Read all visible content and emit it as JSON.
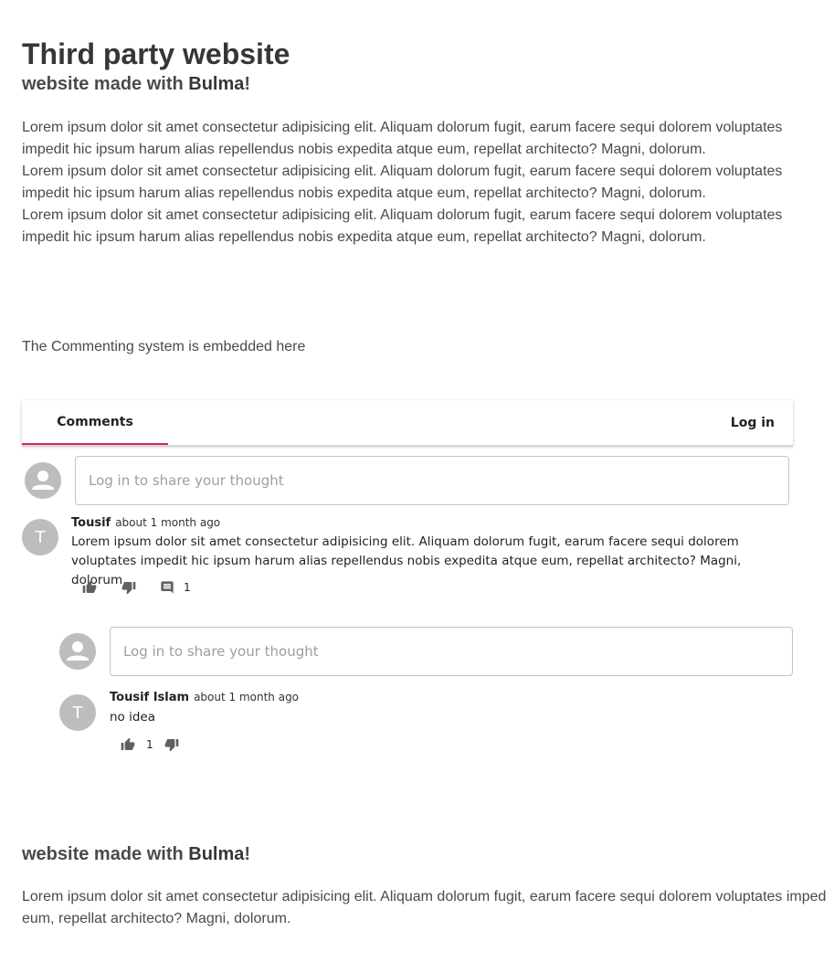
{
  "header": {
    "title": "Third party website",
    "subtitle_prefix": "website made with ",
    "subtitle_brand": "Bulma",
    "subtitle_suffix": "!"
  },
  "intro": {
    "paragraphs": [
      "Lorem ipsum dolor sit amet consectetur adipisicing elit. Aliquam dolorum fugit, earum facere sequi dolorem voluptates impedit hic ipsum harum alias repellendus nobis expedita atque eum, repellat architecto? Magni, dolorum.",
      "Lorem ipsum dolor sit amet consectetur adipisicing elit. Aliquam dolorum fugit, earum facere sequi dolorem voluptates impedit hic ipsum harum alias repellendus nobis expedita atque eum, repellat architecto? Magni, dolorum.",
      "Lorem ipsum dolor sit amet consectetur adipisicing elit. Aliquam dolorum fugit, earum facere sequi dolorem voluptates impedit hic ipsum harum alias repellendus nobis expedita atque eum, repellat architecto? Magni, dolorum."
    ],
    "embed_note": "The Commenting system is embedded here"
  },
  "widget": {
    "tab_comments": "Comments",
    "tab_login": "Log in",
    "accent_color": "#e0245e",
    "main_input_placeholder": "Log in to share your thought",
    "comment": {
      "avatar_letter": "T",
      "author": "Tousif",
      "time": "about 1 month ago",
      "body": "Lorem ipsum dolor sit amet consectetur adipisicing elit. Aliquam dolorum fugit, earum facere sequi dolorem voluptates impedit hic ipsum harum alias repellendus nobis expedita atque eum, repellat architecto? Magni, dolorum.",
      "like_icon": "thumb-up-icon",
      "dislike_icon": "thumb-down-icon",
      "reply_icon": "comment-icon",
      "reply_count": "1"
    },
    "reply_input_placeholder": "Log in to share your thought",
    "reply": {
      "avatar_letter": "T",
      "author": "Tousif Islam",
      "time": "about 1 month ago",
      "body": "no idea",
      "like_count": "1"
    }
  },
  "footer": {
    "subtitle_prefix": "website made with ",
    "subtitle_brand": "Bulma",
    "subtitle_suffix": "!",
    "line1": "Lorem ipsum dolor sit amet consectetur adipisicing elit. Aliquam dolorum fugit, earum facere sequi dolorem voluptates imped",
    "line2": "eum, repellat architecto? Magni, dolorum."
  }
}
